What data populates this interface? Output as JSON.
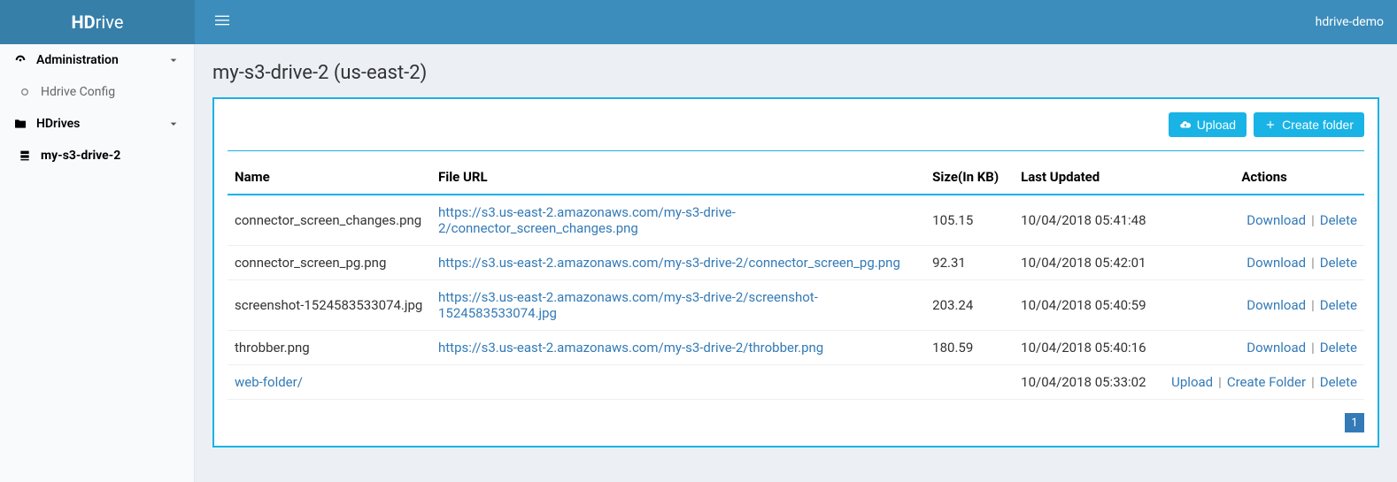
{
  "header": {
    "logo_bold": "HD",
    "logo_rest": "rive",
    "user_label": "hdrive-demo"
  },
  "sidebar": {
    "admin": {
      "label": "Administration"
    },
    "admin_children": [
      {
        "label": "Hdrive Config"
      }
    ],
    "hdrives": {
      "label": "HDrives"
    },
    "hdrives_children": [
      {
        "label": "my-s3-drive-2"
      }
    ]
  },
  "page": {
    "title": "my-s3-drive-2 (us-east-2)",
    "upload_label": "Upload",
    "create_folder_label": "Create folder"
  },
  "table": {
    "headers": {
      "name": "Name",
      "url": "File URL",
      "size": "Size(In KB)",
      "updated": "Last Updated",
      "actions": "Actions"
    },
    "rows": [
      {
        "name": "connector_screen_changes.png",
        "url": "https://s3.us-east-2.amazonaws.com/my-s3-drive-2/connector_screen_changes.png",
        "size": "105.15",
        "updated": "10/04/2018 05:41:48",
        "type": "file",
        "actions": {
          "download": "Download",
          "delete": "Delete"
        }
      },
      {
        "name": "connector_screen_pg.png",
        "url": "https://s3.us-east-2.amazonaws.com/my-s3-drive-2/connector_screen_pg.png",
        "size": "92.31",
        "updated": "10/04/2018 05:42:01",
        "type": "file",
        "actions": {
          "download": "Download",
          "delete": "Delete"
        }
      },
      {
        "name": "screenshot-1524583533074.jpg",
        "url": "https://s3.us-east-2.amazonaws.com/my-s3-drive-2/screenshot-1524583533074.jpg",
        "size": "203.24",
        "updated": "10/04/2018 05:40:59",
        "type": "file",
        "actions": {
          "download": "Download",
          "delete": "Delete"
        }
      },
      {
        "name": "throbber.png",
        "url": "https://s3.us-east-2.amazonaws.com/my-s3-drive-2/throbber.png",
        "size": "180.59",
        "updated": "10/04/2018 05:40:16",
        "type": "file",
        "actions": {
          "download": "Download",
          "delete": "Delete"
        }
      },
      {
        "name": "web-folder/",
        "url": "",
        "size": "",
        "updated": "10/04/2018 05:33:02",
        "type": "folder",
        "actions": {
          "upload": "Upload",
          "create_folder": "Create Folder",
          "delete": "Delete"
        }
      }
    ]
  },
  "pagination": {
    "current": "1"
  }
}
